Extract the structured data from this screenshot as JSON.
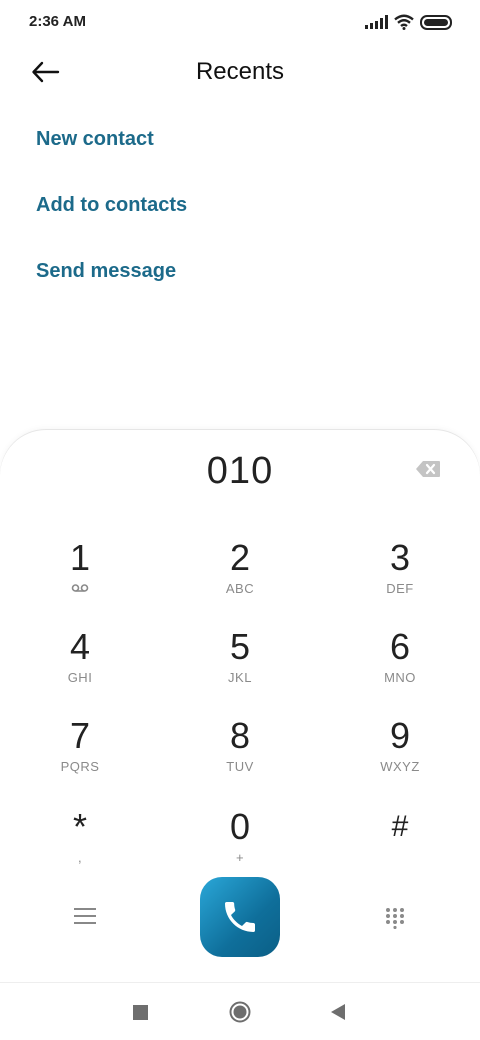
{
  "status_bar": {
    "time": "2:36 AM",
    "icons": [
      "signal-icon",
      "wifi-icon",
      "battery-icon"
    ]
  },
  "header": {
    "title": "Recents",
    "back_icon": "arrow-left-icon"
  },
  "actions": [
    {
      "label": "New contact"
    },
    {
      "label": "Add to contacts"
    },
    {
      "label": "Send message"
    }
  ],
  "dialer": {
    "number": "010",
    "delete_icon": "backspace-icon",
    "keys": [
      {
        "digit": "1",
        "letters": "voicemail-icon"
      },
      {
        "digit": "2",
        "letters": "ABC"
      },
      {
        "digit": "3",
        "letters": "DEF"
      },
      {
        "digit": "4",
        "letters": "GHI"
      },
      {
        "digit": "5",
        "letters": "JKL"
      },
      {
        "digit": "6",
        "letters": "MNO"
      },
      {
        "digit": "7",
        "letters": "PQRS"
      },
      {
        "digit": "8",
        "letters": "TUV"
      },
      {
        "digit": "9",
        "letters": "WXYZ"
      },
      {
        "digit": "*",
        "letters": ","
      },
      {
        "digit": "0",
        "letters": "+"
      },
      {
        "digit": "#",
        "letters": ""
      }
    ],
    "menu_icon": "menu-icon",
    "call_icon": "phone-icon",
    "keypad_icon": "dialpad-icon"
  },
  "colors": {
    "accent": "#1c6a8a",
    "call_gradient_start": "#2aa7d8",
    "call_gradient_end": "#0b5f86"
  },
  "nav": {
    "icons": [
      "recents-square-icon",
      "home-circle-icon",
      "back-triangle-icon"
    ]
  }
}
